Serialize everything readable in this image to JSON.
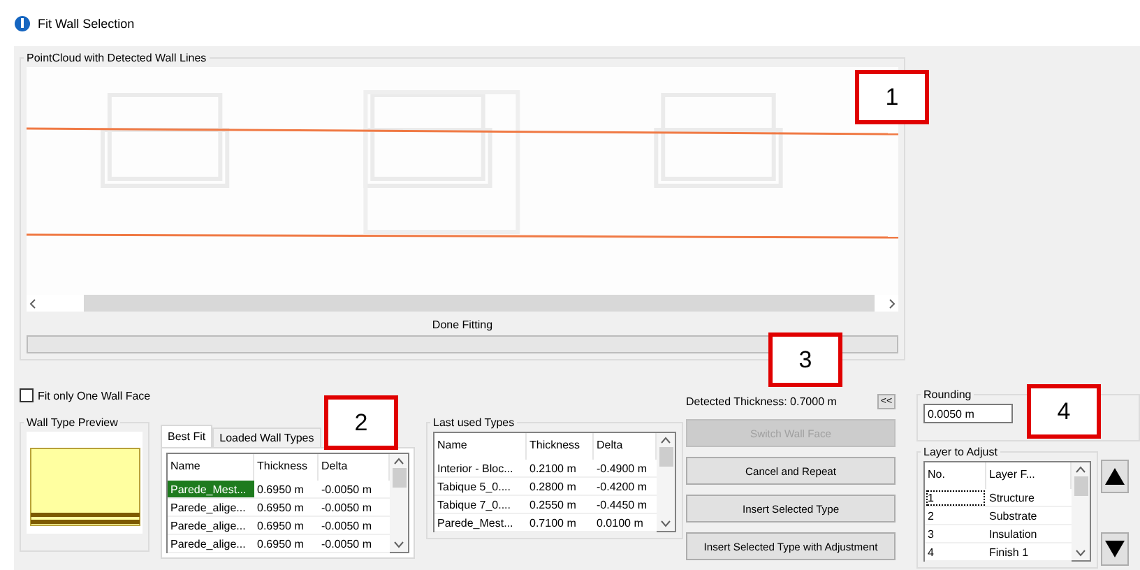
{
  "window": {
    "title": "Fit Wall Selection"
  },
  "pointcloud": {
    "title": "PointCloud with Detected Wall Lines",
    "status": "Done Fitting",
    "kind": "picture"
  },
  "fit_one_face": {
    "label": "Fit only One Wall Face",
    "checked": false
  },
  "preview": {
    "title": "Wall Type Preview"
  },
  "tabs": [
    {
      "label": "Best Fit",
      "selected": true
    },
    {
      "label": "Loaded Wall Types",
      "selected": false
    }
  ],
  "best_fit": {
    "columns": [
      "Name",
      "Thickness",
      "Delta"
    ],
    "rows": [
      {
        "cells": [
          "Parede_Mest...",
          "0.6950 m",
          "-0.0050 m"
        ],
        "selected": true
      },
      {
        "cells": [
          "Parede_alige...",
          "0.6950 m",
          "-0.0050 m"
        ],
        "selected": false
      },
      {
        "cells": [
          "Parede_alige...",
          "0.6950 m",
          "-0.0050 m"
        ],
        "selected": false
      },
      {
        "cells": [
          "Parede_alige...",
          "0.6950 m",
          "-0.0050 m"
        ],
        "selected": false
      }
    ]
  },
  "last_used": {
    "title": "Last used Types",
    "columns": [
      "Name",
      "Thickness",
      "Delta"
    ],
    "rows": [
      {
        "cells": [
          "Interior - Bloc...",
          "0.2100 m",
          "-0.4900 m"
        ],
        "selected": false
      },
      {
        "cells": [
          "Tabique 5_0....",
          "0.2800 m",
          "-0.4200 m"
        ],
        "selected": false
      },
      {
        "cells": [
          "Tabique 7_0....",
          "0.2550 m",
          "-0.4450 m"
        ],
        "selected": false
      },
      {
        "cells": [
          "Parede_Mest...",
          "0.7100 m",
          "0.0100 m"
        ],
        "selected": false
      }
    ]
  },
  "detected_thickness": "Detected Thickness: 0.7000 m",
  "collapse_button": "<<",
  "buttons": [
    {
      "label": "Switch Wall Face",
      "disabled": true
    },
    {
      "label": "Cancel and Repeat",
      "disabled": false
    },
    {
      "label": "Insert Selected Type",
      "disabled": false
    },
    {
      "label": "Insert Selected Type with Adjustment",
      "disabled": false
    }
  ],
  "rounding": {
    "title": "Rounding",
    "value": "0.0050 m"
  },
  "layers": {
    "title": "Layer to Adjust",
    "columns": [
      "No.",
      "Layer F..."
    ],
    "rows": [
      {
        "cells": [
          "1",
          "Structure"
        ],
        "selected": true
      },
      {
        "cells": [
          "2",
          "Substrate"
        ],
        "selected": false
      },
      {
        "cells": [
          "3",
          "Insulation"
        ],
        "selected": false
      },
      {
        "cells": [
          "4",
          "Finish 1"
        ],
        "selected": false
      }
    ]
  },
  "callouts": [
    "1",
    "2",
    "3",
    "4"
  ]
}
